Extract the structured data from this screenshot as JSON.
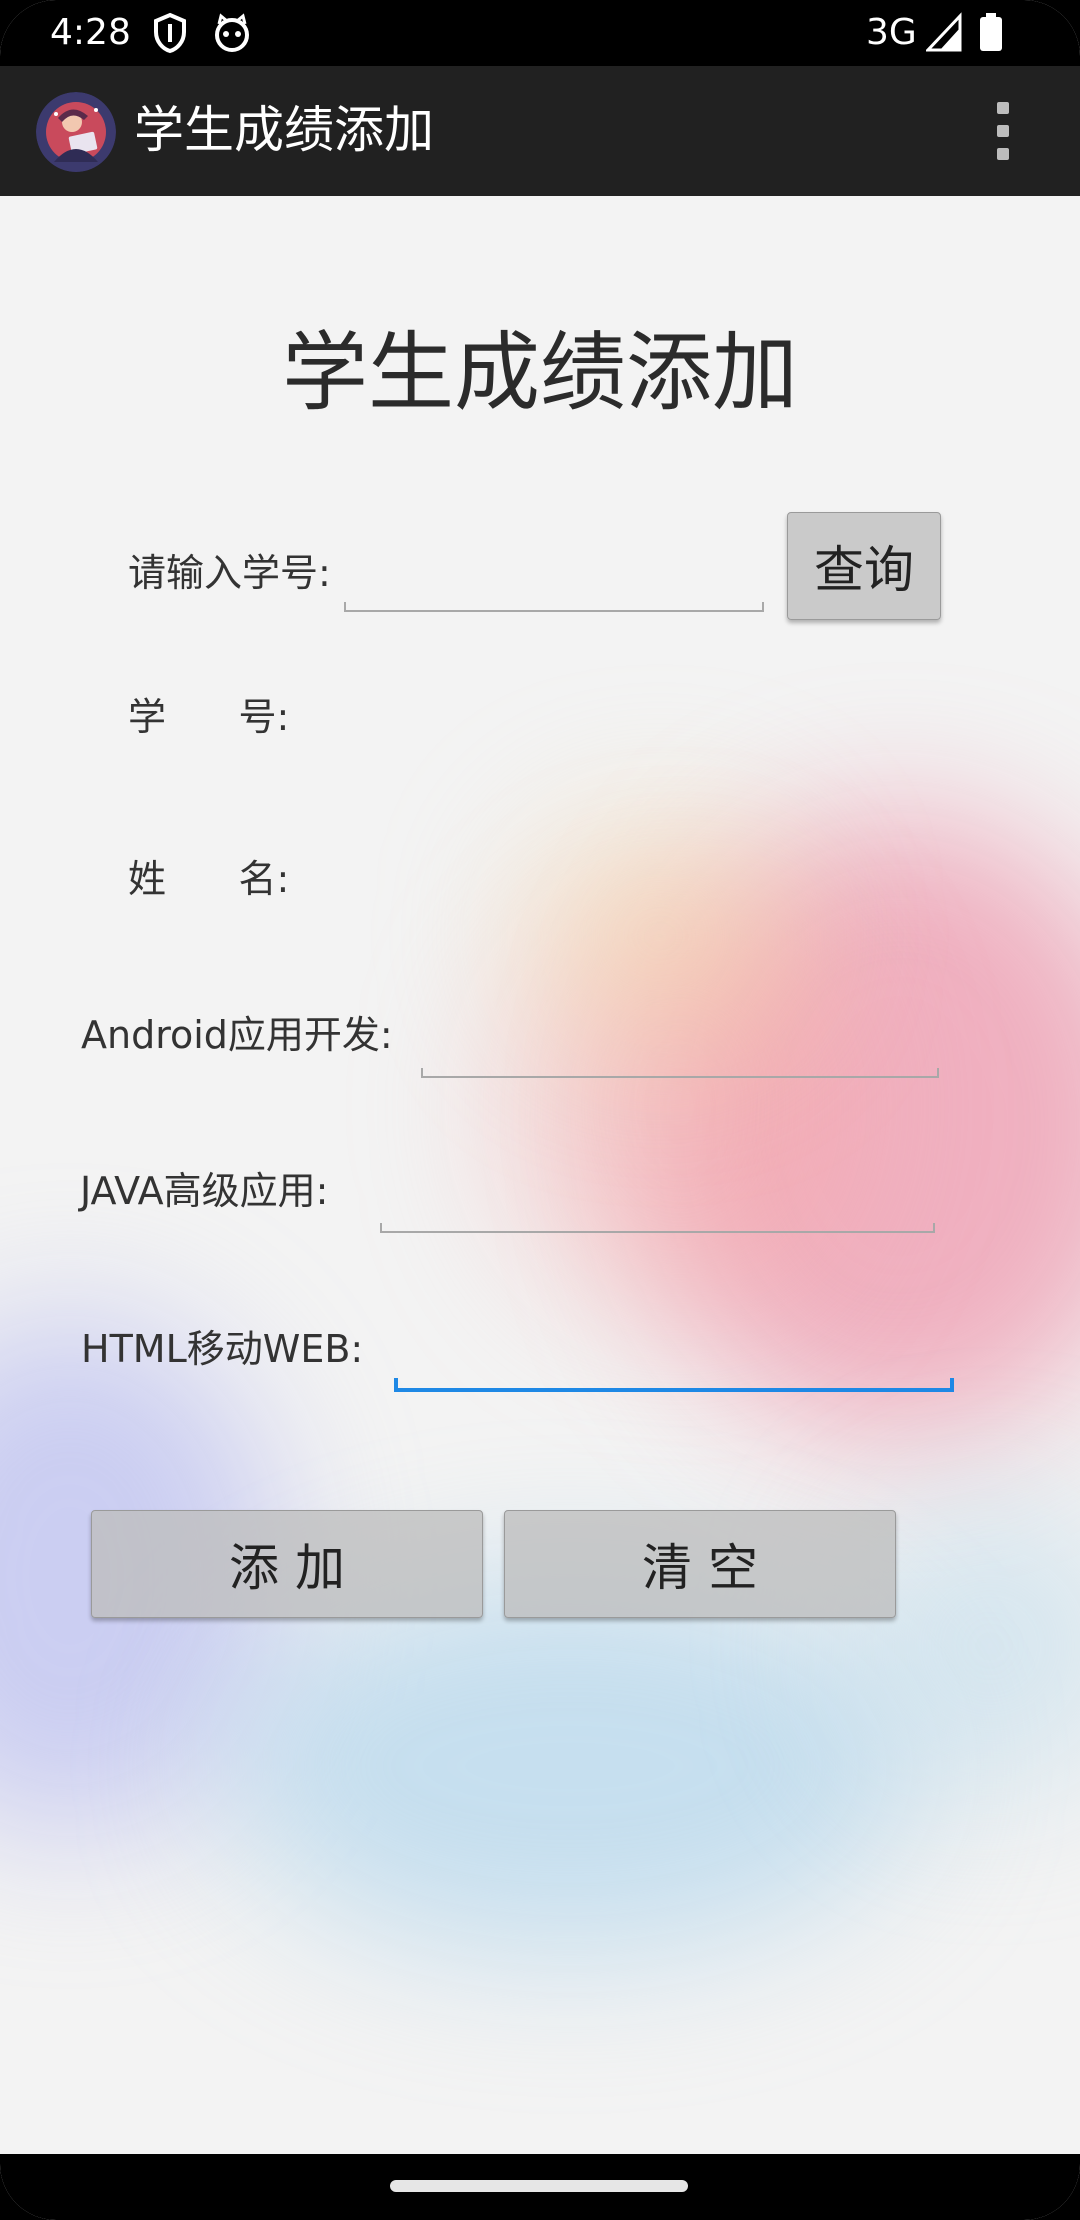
{
  "status_bar": {
    "time": "4:28",
    "network": "3G",
    "icons": [
      "shield-icon",
      "cat-face-icon",
      "signal-icon",
      "battery-icon"
    ]
  },
  "app_bar": {
    "title": "学生成绩添加",
    "menu_icon": "more-vert-icon"
  },
  "form": {
    "heading": "学生成绩添加",
    "query": {
      "label": "请输入学号:",
      "value": "",
      "button": "查询"
    },
    "student_id": {
      "label": "学      号:",
      "value": ""
    },
    "student_name": {
      "label": "姓      名:",
      "value": ""
    },
    "scores": [
      {
        "label": "Android应用开发:",
        "value": ""
      },
      {
        "label": "JAVA高级应用:",
        "value": ""
      },
      {
        "label": "HTML移动WEB:",
        "value": ""
      }
    ],
    "add_button": "添  加",
    "clear_button": "清  空"
  },
  "colors": {
    "app_bar": "#212121",
    "accent": "#1e88e5",
    "background": "#f3f3f3"
  }
}
